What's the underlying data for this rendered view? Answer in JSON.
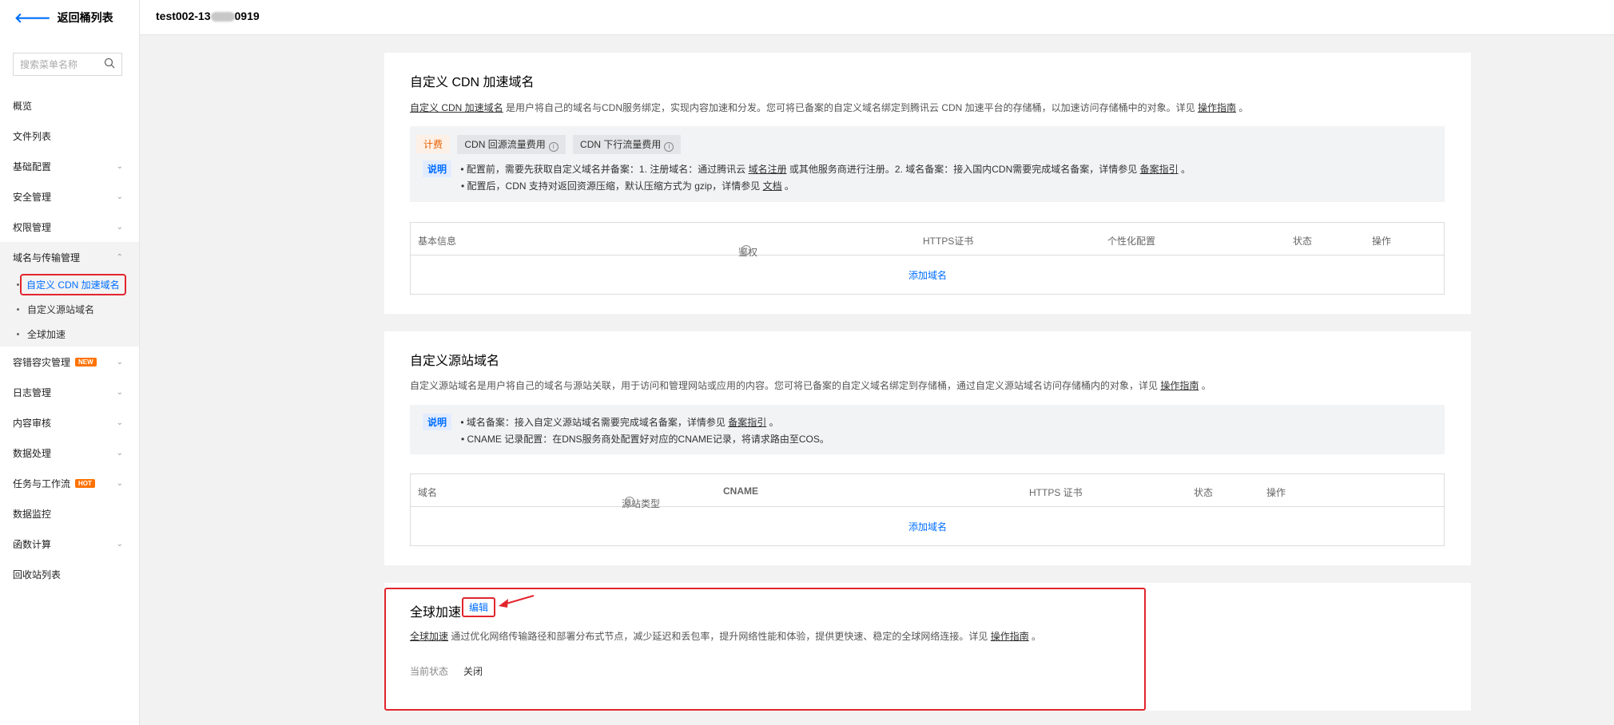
{
  "sidebar": {
    "back_label": "返回桶列表",
    "search_placeholder": "搜索菜单名称",
    "items": {
      "overview": "概览",
      "files": "文件列表",
      "basic": "基础配置",
      "security": "安全管理",
      "permission": "权限管理",
      "domain": "域名与传输管理",
      "disaster": "容错容灾管理",
      "log": "日志管理",
      "audit": "内容审核",
      "data": "数据处理",
      "workflow": "任务与工作流",
      "monitor": "数据监控",
      "function": "函数计算",
      "recycle": "回收站列表"
    },
    "sub_items": {
      "cdn": "自定义 CDN 加速域名",
      "origin": "自定义源站域名",
      "global": "全球加速"
    },
    "badges": {
      "new": "NEW",
      "hot": "HOT"
    }
  },
  "header": {
    "bucket_prefix": "test002-13",
    "bucket_suffix": "0919"
  },
  "cdn_panel": {
    "title": "自定义 CDN 加速域名",
    "desc_link": "自定义 CDN 加速域名",
    "desc_text": " 是用户将自己的域名与CDN服务绑定，实现内容加速和分发。您可将已备案的自定义域名绑定到腾讯云 CDN 加速平台的存储桶，以加速访问存储桶中的对象。详见 ",
    "desc_guide": "操作指南",
    "desc_end": " 。",
    "fee_tag": "计费",
    "fee_item1": "CDN 回源流量费用",
    "fee_item2": "CDN 下行流量费用",
    "note_tag": "说明",
    "note1_a": "• 配置前，需要先获取自定义域名并备案：1. 注册域名：通过腾讯云 ",
    "note1_link1": "域名注册",
    "note1_b": " 或其他服务商进行注册。2. 域名备案：接入国内CDN需要完成域名备案，详情参见 ",
    "note1_link2": "备案指引",
    "note1_c": " 。",
    "note2_a": "• 配置后，CDN 支持对返回资源压缩，默认压缩方式为 gzip，详情参见 ",
    "note2_link": "文档",
    "note2_c": " 。",
    "columns": {
      "basic": "基本信息",
      "auth": "鉴权",
      "https": "HTTPS证书",
      "custom": "个性化配置",
      "status": "状态",
      "action": "操作"
    },
    "add_link": "添加域名"
  },
  "origin_panel": {
    "title": "自定义源站域名",
    "desc_text": "自定义源站域名是用户将自己的域名与源站关联，用于访问和管理网站或应用的内容。您可将已备案的自定义域名绑定到存储桶，通过自定义源站域名访问存储桶内的对象，详见 ",
    "desc_guide": "操作指南",
    "desc_end": " 。",
    "note_tag": "说明",
    "note1_a": "• 域名备案：接入自定义源站域名需要完成域名备案，详情参见 ",
    "note1_link": "备案指引",
    "note1_c": " 。",
    "note2": "• CNAME 记录配置：在DNS服务商处配置好对应的CNAME记录，将请求路由至COS。",
    "columns": {
      "domain": "域名",
      "origin_type": "源站类型",
      "cname": "CNAME",
      "https": "HTTPS 证书",
      "status": "状态",
      "action": "操作"
    },
    "add_link": "添加域名"
  },
  "global_panel": {
    "title": "全球加速",
    "edit": "编辑",
    "desc_link": "全球加速",
    "desc_text": " 通过优化网络传输路径和部署分布式节点，减少延迟和丢包率，提升网络性能和体验，提供更快速、稳定的全球网络连接。详见 ",
    "desc_guide": "操作指南",
    "desc_end": " 。",
    "status_label": "当前状态",
    "status_value": "关闭"
  },
  "colors": {
    "accent": "#006eff",
    "highlight": "#e2252d",
    "fee": "#e66000"
  }
}
